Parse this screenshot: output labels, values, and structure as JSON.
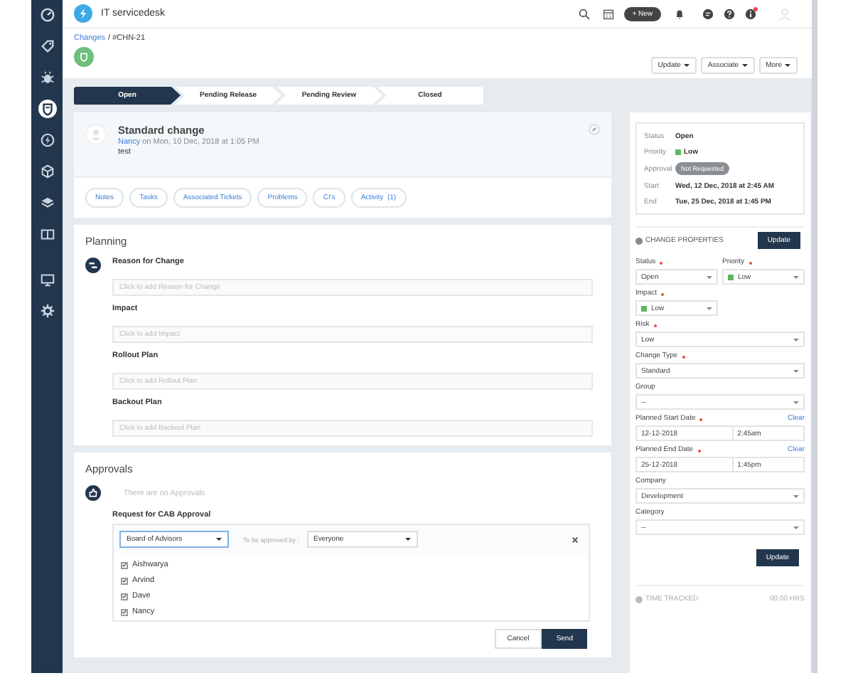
{
  "sidebar": {
    "items": [
      {
        "selected": false
      },
      {
        "selected": false
      },
      {
        "selected": false
      },
      {
        "selected": true
      },
      {
        "selected": false
      },
      {
        "selected": false
      },
      {
        "selected": false
      },
      {
        "selected": false
      },
      {
        "selected": false
      },
      {
        "selected": false
      }
    ]
  },
  "header": {
    "app_name": "IT servicedesk",
    "new_button": "+ New"
  },
  "breadcrumb": {
    "link": "Changes",
    "current": "/ #CHN-21"
  },
  "actions": [
    "Update",
    "Associate",
    "More"
  ],
  "stepper": [
    {
      "label": "Open",
      "selected": true
    },
    {
      "label": "Pending Release",
      "selected": false
    },
    {
      "label": "Pending Review",
      "selected": false
    },
    {
      "label": "Closed",
      "selected": false
    }
  ],
  "change": {
    "title": "Standard change",
    "author": "Nancy",
    "meta": "on Mon, 10 Dec, 2018 at 1:05 PM",
    "description": "test"
  },
  "tabs": [
    "Notes",
    "Tasks",
    "Associated Tickets",
    "Problems",
    "CI's",
    "Activity  (1)"
  ],
  "planning": {
    "title": "Planning",
    "fields": [
      {
        "label": "Reason for Change",
        "placeholder": "Click to add Reason for Change"
      },
      {
        "label": "Impact",
        "placeholder": "Click to add Impact"
      },
      {
        "label": "Rollout Plan",
        "placeholder": "Click to add Rollout Plan"
      },
      {
        "label": "Backout Plan",
        "placeholder": "Click to add Backout Plan"
      }
    ]
  },
  "approvals": {
    "title": "Approvals",
    "empty": "There are no Approvals",
    "request_title": "Request for CAB Approval",
    "cab": "Board of Advisors",
    "approved_by_label": "To be approved by :",
    "approved_by": "Everyone",
    "members": [
      {
        "name": "Aishwarya",
        "checked": true
      },
      {
        "name": "Arvind",
        "checked": true
      },
      {
        "name": "Dave",
        "checked": true
      },
      {
        "name": "Nancy",
        "checked": true
      }
    ],
    "cancel": "Cancel",
    "send": "Send"
  },
  "summary": [
    {
      "label": "Status",
      "value": "Open",
      "kind": "text"
    },
    {
      "label": "Priority",
      "value": "Low",
      "kind": "priority",
      "color": "#5cb85c"
    },
    {
      "label": "Approval",
      "value": "Not Requested",
      "kind": "pill"
    },
    {
      "label": "Start",
      "value": "Wed, 12 Dec, 2018 at 2:45 AM",
      "kind": "text"
    },
    {
      "label": "End",
      "value": "Tue, 25 Dec, 2018 at 1:45 PM",
      "kind": "text"
    }
  ],
  "properties": {
    "title": "CHANGE PROPERTIES",
    "update": "Update",
    "fields": [
      {
        "label": "Status",
        "required": true,
        "kind": "short-select",
        "value": "Open"
      },
      {
        "label": "Priority",
        "required": true,
        "kind": "short-select",
        "value": "Low",
        "color": "#5cb85c"
      },
      {
        "label": "Impact",
        "required": true,
        "kind": "short-select",
        "value": "Low",
        "color": "#5cb85c"
      },
      {
        "label": "Risk",
        "required": true,
        "kind": "select",
        "value": "Low"
      },
      {
        "label": "Change Type",
        "required": true,
        "kind": "select",
        "value": "Standard"
      },
      {
        "label": "Group",
        "required": false,
        "kind": "select",
        "value": "--"
      },
      {
        "label": "Planned Start Date",
        "required": true,
        "kind": "datetime",
        "date": "12-12-2018",
        "time": "2:45am",
        "clear": "Clear"
      },
      {
        "label": "Planned End Date",
        "required": true,
        "kind": "datetime",
        "date": "25-12-2018",
        "time": "1:45pm",
        "clear": "Clear"
      },
      {
        "label": "Company",
        "required": false,
        "kind": "select",
        "value": "Development"
      },
      {
        "label": "Category",
        "required": false,
        "kind": "select",
        "value": "--"
      }
    ],
    "bottom_update": "Update"
  },
  "time_tracked": {
    "label": "TIME TRACKED",
    "value": "00:00 HRS"
  }
}
